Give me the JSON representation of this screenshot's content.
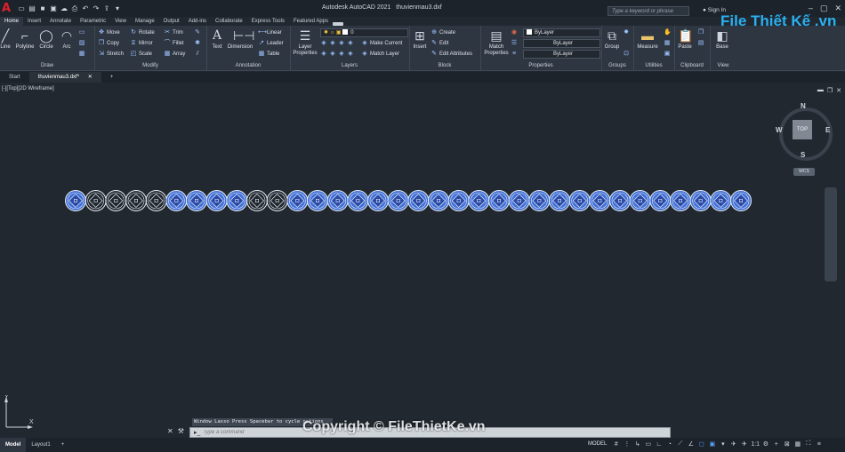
{
  "app": {
    "title": "Autodesk AutoCAD 2021",
    "filename": "thuvienmau3.dxf",
    "search_placeholder": "Type a keyword or phrase",
    "signin": "Sign In"
  },
  "ribbon_tabs": [
    "Home",
    "Insert",
    "Annotate",
    "Parametric",
    "View",
    "Manage",
    "Output",
    "Add-ins",
    "Collaborate",
    "Express Tools",
    "Featured Apps"
  ],
  "panels": {
    "draw": {
      "label": "Draw",
      "tools": [
        "Line",
        "Polyline",
        "Circle",
        "Arc"
      ]
    },
    "modify": {
      "label": "Modify",
      "tools": [
        "Move",
        "Rotate",
        "Trim",
        "Copy",
        "Mirror",
        "Fillet",
        "Stretch",
        "Scale",
        "Array"
      ]
    },
    "annotation": {
      "label": "Annotation",
      "tools": [
        "Text",
        "Dimension",
        "Linear",
        "Leader",
        "Table"
      ]
    },
    "layers": {
      "label": "Layers",
      "layer_props": "Layer Properties",
      "current_layer": "0",
      "make_current": "Make Current",
      "match_layer": "Match Layer"
    },
    "block": {
      "label": "Block",
      "insert": "Insert",
      "create": "Create",
      "edit": "Edit",
      "edit_attributes": "Edit Attributes"
    },
    "properties": {
      "label": "Properties",
      "match": "Match Properties",
      "color": "ByLayer",
      "linetype": "ByLayer",
      "lineweight": "ByLayer"
    },
    "groups": {
      "label": "Groups",
      "group": "Group"
    },
    "utilities": {
      "label": "Utilities",
      "measure": "Measure"
    },
    "clipboard": {
      "label": "Clipboard",
      "paste": "Paste"
    },
    "view": {
      "label": "View",
      "base": "Base"
    }
  },
  "doc_tabs": [
    "Start",
    "thuvienmau3.dxf*"
  ],
  "viewport": {
    "label": "[-][Top][2D Wireframe]",
    "viewcube": {
      "face": "TOP",
      "n": "N",
      "s": "S",
      "e": "E",
      "w": "W"
    },
    "wcs": "WCS",
    "ucs_x": "X",
    "ucs_y": "Y"
  },
  "command": {
    "history": "Window Lasso  Press Spacebar to cycle options",
    "placeholder": "Type a command"
  },
  "layout_tabs": [
    "Model",
    "Layout1"
  ],
  "status": {
    "model": "MODEL",
    "scale": "1:1"
  },
  "watermark": "Copyright © FileThietKe.vn",
  "brand": "File Thiết Kế .vn",
  "drawing": {
    "ornament_count": 34,
    "accent_color": "#3f6fd8",
    "outline_only_indices": [
      1,
      2,
      3,
      4,
      9,
      10
    ]
  }
}
